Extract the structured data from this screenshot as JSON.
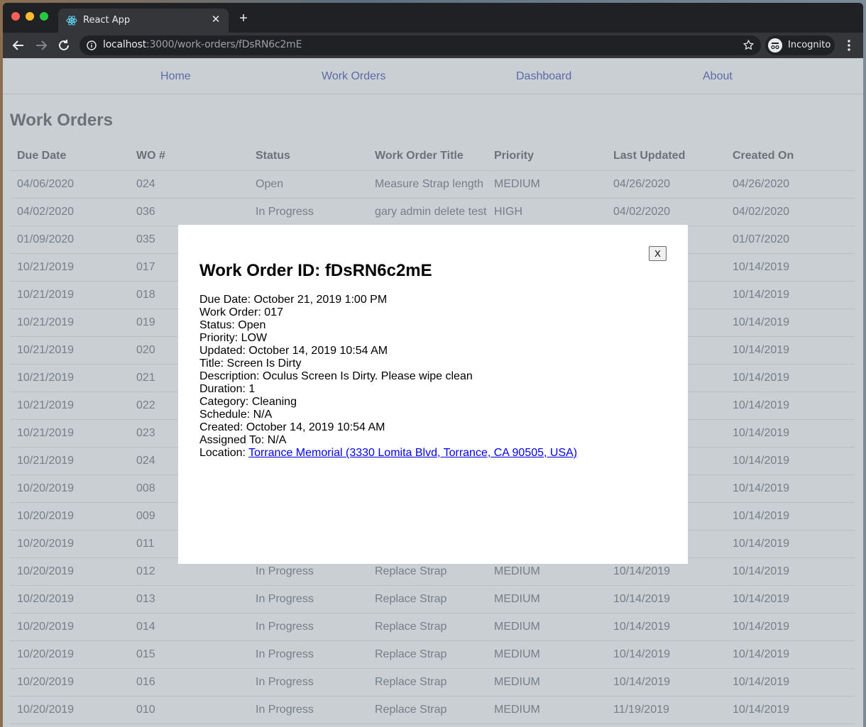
{
  "browser": {
    "tab_title": "React App",
    "url_host": "localhost",
    "url_path": ":3000/work-orders/fDsRN6c2mE",
    "profile_label": "Incognito"
  },
  "nav": {
    "home": "Home",
    "work_orders": "Work Orders",
    "dashboard": "Dashboard",
    "about": "About"
  },
  "page": {
    "title": "Work Orders"
  },
  "table": {
    "headers": [
      "Due Date",
      "WO #",
      "Status",
      "Work Order Title",
      "Priority",
      "Last Updated",
      "Created On"
    ],
    "rows": [
      [
        "04/06/2020",
        "024",
        "Open",
        "Measure Strap length",
        "MEDIUM",
        "04/26/2020",
        "04/26/2020"
      ],
      [
        "04/02/2020",
        "036",
        "In Progress",
        "gary admin delete test",
        "HIGH",
        "04/02/2020",
        "04/02/2020"
      ],
      [
        "01/09/2020",
        "035",
        "",
        "",
        "",
        "",
        "01/07/2020"
      ],
      [
        "10/21/2019",
        "017",
        "",
        "",
        "",
        "",
        "10/14/2019"
      ],
      [
        "10/21/2019",
        "018",
        "",
        "",
        "",
        "",
        "10/14/2019"
      ],
      [
        "10/21/2019",
        "019",
        "",
        "",
        "",
        "",
        "10/14/2019"
      ],
      [
        "10/21/2019",
        "020",
        "",
        "",
        "",
        "",
        "10/14/2019"
      ],
      [
        "10/21/2019",
        "021",
        "",
        "",
        "",
        "",
        "10/14/2019"
      ],
      [
        "10/21/2019",
        "022",
        "",
        "",
        "",
        "",
        "10/14/2019"
      ],
      [
        "10/21/2019",
        "023",
        "",
        "",
        "",
        "",
        "10/14/2019"
      ],
      [
        "10/21/2019",
        "024",
        "",
        "",
        "",
        "",
        "10/14/2019"
      ],
      [
        "10/20/2019",
        "008",
        "",
        "",
        "",
        "",
        "10/14/2019"
      ],
      [
        "10/20/2019",
        "009",
        "",
        "",
        "",
        "",
        "10/14/2019"
      ],
      [
        "10/20/2019",
        "011",
        "",
        "",
        "",
        "",
        "10/14/2019"
      ],
      [
        "10/20/2019",
        "012",
        "In Progress",
        "Replace Strap",
        "MEDIUM",
        "10/14/2019",
        "10/14/2019"
      ],
      [
        "10/20/2019",
        "013",
        "In Progress",
        "Replace Strap",
        "MEDIUM",
        "10/14/2019",
        "10/14/2019"
      ],
      [
        "10/20/2019",
        "014",
        "In Progress",
        "Replace Strap",
        "MEDIUM",
        "10/14/2019",
        "10/14/2019"
      ],
      [
        "10/20/2019",
        "015",
        "In Progress",
        "Replace Strap",
        "MEDIUM",
        "10/14/2019",
        "10/14/2019"
      ],
      [
        "10/20/2019",
        "016",
        "In Progress",
        "Replace Strap",
        "MEDIUM",
        "10/14/2019",
        "10/14/2019"
      ],
      [
        "10/20/2019",
        "010",
        "In Progress",
        "Replace Strap",
        "MEDIUM",
        "11/19/2019",
        "10/14/2019"
      ]
    ]
  },
  "modal": {
    "close_label": "X",
    "title": "Work Order ID: fDsRN6c2mE",
    "details": [
      "Due Date: October 21, 2019 1:00 PM",
      "Work Order: 017",
      "Status: Open",
      "Priority: LOW",
      "Updated: October 14, 2019 10:54 AM",
      "Title: Screen Is Dirty",
      "Description: Oculus Screen Is Dirty. Please wipe clean",
      "Duration: 1",
      "Category: Cleaning",
      "Schedule: N/A",
      "Created: October 14, 2019 10:54 AM",
      "Assigned To: N/A"
    ],
    "location_label": "Location: ",
    "location_link": "Torrance Memorial (3330 Lomita Blvd, Torrance, CA 90505, USA)"
  },
  "colors": {
    "link": "#3f51b5",
    "location_link": "#0000ee",
    "browser_frame": "#202124",
    "toolbar": "#35363a"
  },
  "icons": [
    "react-favicon-icon",
    "close-tab-icon",
    "new-tab-icon",
    "back-icon",
    "forward-icon",
    "reload-icon",
    "info-icon",
    "bookmark-star-icon",
    "incognito-icon",
    "kebab-menu-icon"
  ]
}
